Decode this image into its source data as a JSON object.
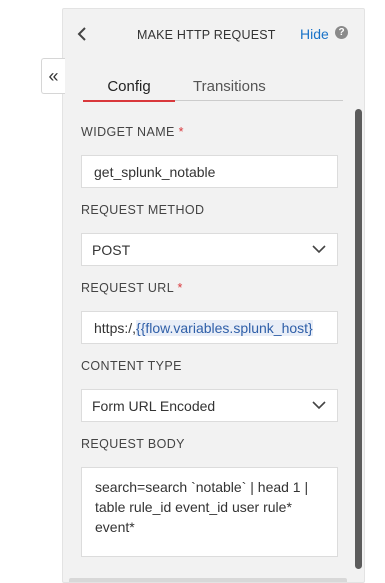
{
  "panel": {
    "title": "MAKE HTTP REQUEST",
    "hide_label": "Hide",
    "help_glyph": "?",
    "collapse_glyph": "«"
  },
  "tabs": [
    {
      "label": "Config",
      "active": true
    },
    {
      "label": "Transitions",
      "active": false
    }
  ],
  "form": {
    "widget_name": {
      "label": "WIDGET NAME",
      "required_mark": "*",
      "value": "get_splunk_notable"
    },
    "request_method": {
      "label": "REQUEST METHOD",
      "value": "POST"
    },
    "request_url": {
      "label": "REQUEST URL",
      "required_mark": "*",
      "prefix": "https:/,",
      "variable": "{{flow.variables.splunk_host}"
    },
    "content_type": {
      "label": "CONTENT TYPE",
      "value": "Form URL Encoded"
    },
    "request_body": {
      "label": "REQUEST BODY",
      "value": "search=search `notable` | head 1 | table rule_id event_id user rule* event*"
    }
  },
  "colors": {
    "accent_red": "#d9383c",
    "link_blue": "#1a73c8"
  },
  "icons": [
    "collapse-icon",
    "back-icon",
    "help-icon",
    "chevron-down-icon"
  ]
}
